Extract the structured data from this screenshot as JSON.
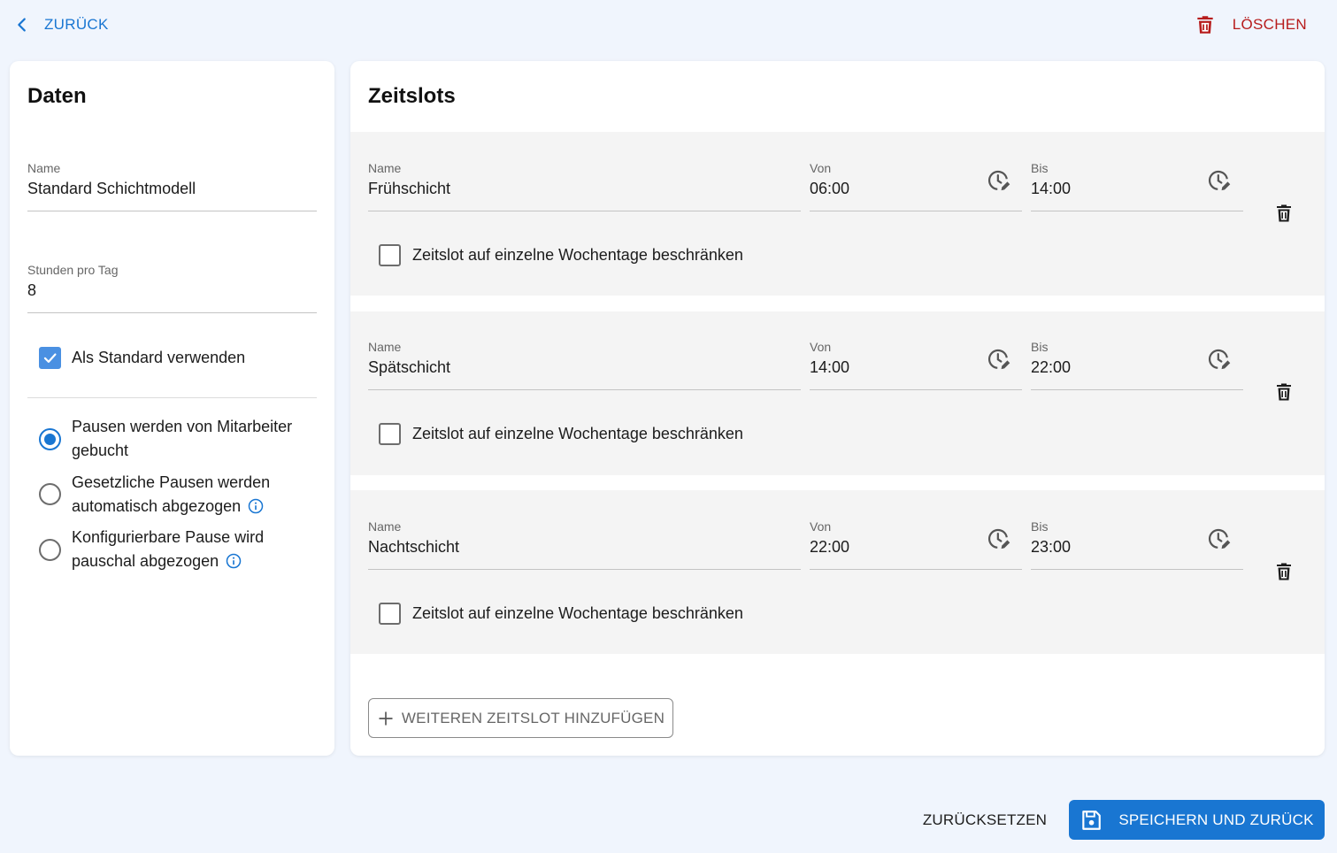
{
  "header": {
    "back_label": "ZURÜCK",
    "delete_label": "LÖSCHEN"
  },
  "data_card": {
    "title": "Daten",
    "name_label": "Name",
    "name_value": "Standard Schichtmodell",
    "hours_label": "Stunden pro Tag",
    "hours_value": "8",
    "default_checkbox_label": "Als Standard verwenden",
    "default_checked": true,
    "break_options": [
      {
        "label": "Pausen werden von Mitarbeiter gebucht",
        "selected": true,
        "has_info": false
      },
      {
        "label": "Gesetzliche Pausen werden automatisch abgezogen",
        "selected": false,
        "has_info": true
      },
      {
        "label": "Konfigurierbare Pause wird pauschal abgezogen",
        "selected": false,
        "has_info": true
      }
    ]
  },
  "slots_card": {
    "title": "Zeitslots",
    "field_labels": {
      "name": "Name",
      "from": "Von",
      "to": "Bis"
    },
    "restrict_label": "Zeitslot auf einzelne Wochentage beschränken",
    "slots": [
      {
        "name": "Frühschicht",
        "from": "06:00",
        "to": "14:00",
        "restricted": false
      },
      {
        "name": "Spätschicht",
        "from": "14:00",
        "to": "22:00",
        "restricted": false
      },
      {
        "name": "Nachtschicht",
        "from": "22:00",
        "to": "23:00",
        "restricted": false
      }
    ],
    "add_label": "WEITEREN ZEITSLOT HINZUFÜGEN"
  },
  "footer": {
    "reset_label": "ZURÜCKSETZEN",
    "save_label": "SPEICHERN UND ZURÜCK"
  },
  "colors": {
    "primary": "#1976d2",
    "danger": "#b71c1c",
    "background": "#f0f5fd",
    "slot_background": "#f4f4f4"
  },
  "icons": [
    "chevron-left-icon",
    "trash-icon",
    "clock-edit-icon",
    "info-icon",
    "plus-icon",
    "save-icon",
    "check-icon"
  ]
}
